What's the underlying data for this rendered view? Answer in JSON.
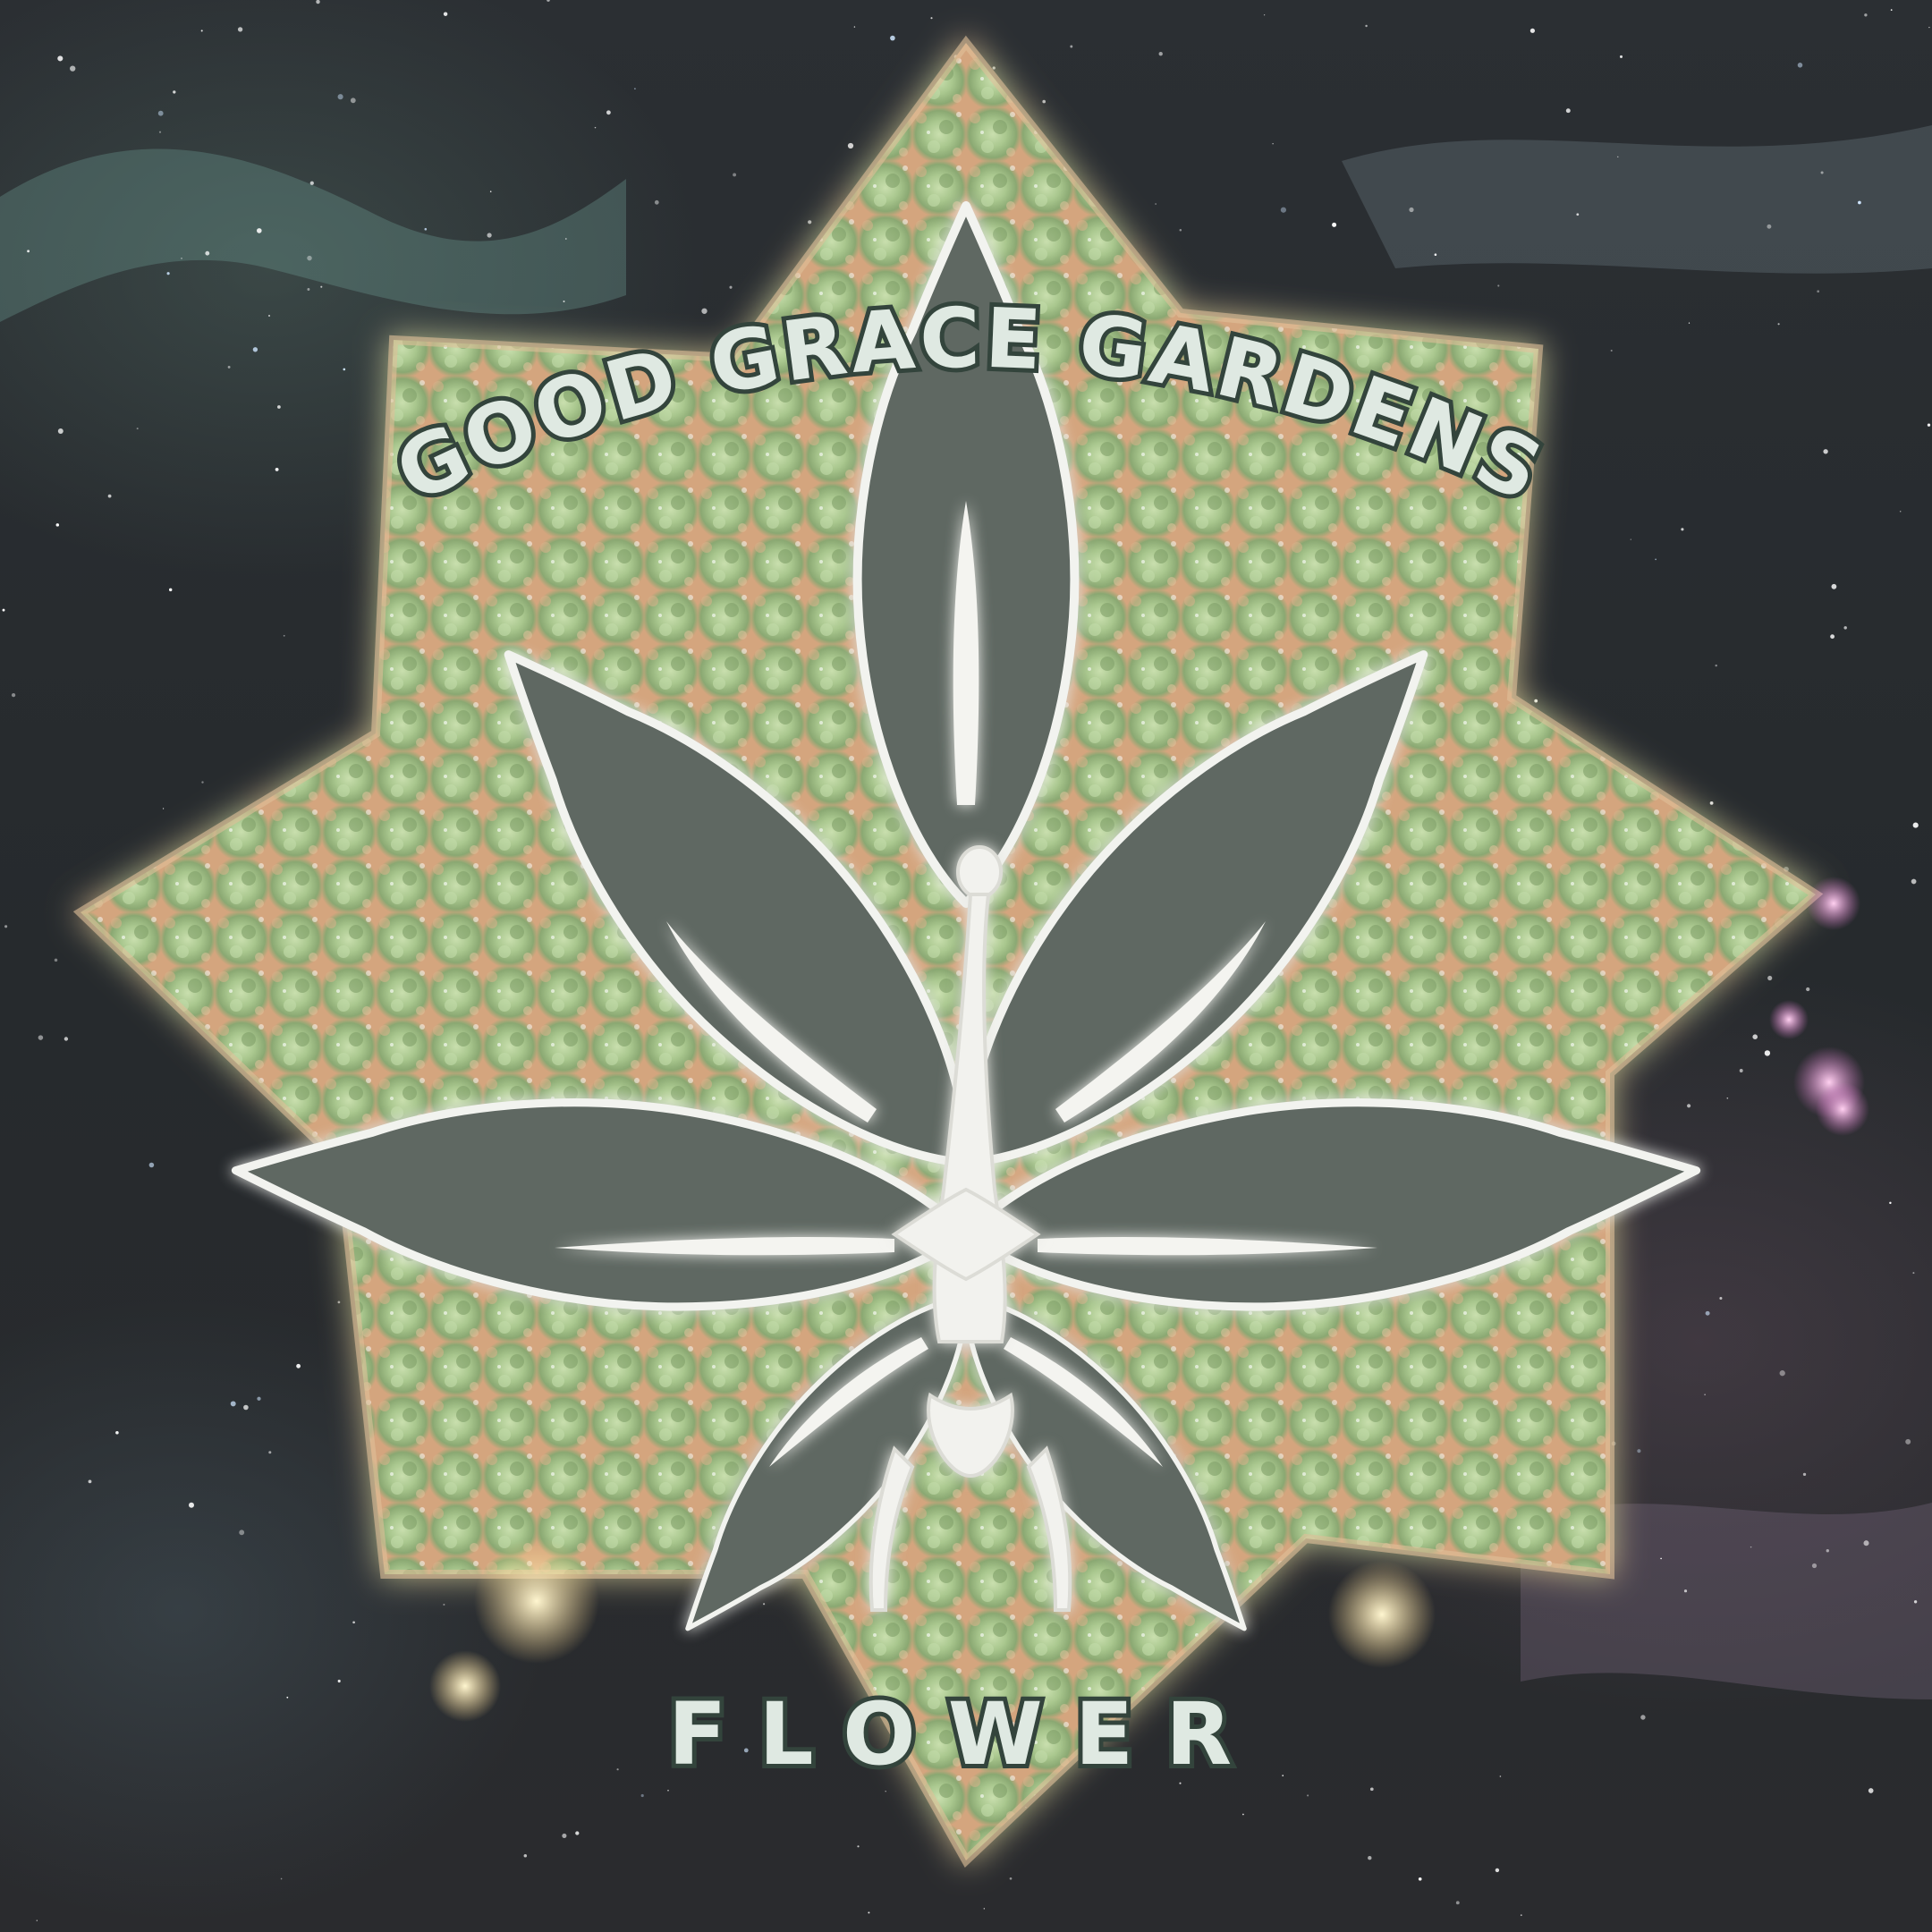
{
  "brand": {
    "name": "GOOD GRACE GARDENS",
    "subtitle": "FLOWER"
  },
  "colors": {
    "background": "#262a2d",
    "bud_light": "#b9d49a",
    "bud_dark": "#6f8a5c",
    "bud_orange": "#d9a47a",
    "leaf_fill": "#5f6862",
    "leaf_outline": "#f2f3ef",
    "text_fill": "#dfe9e2",
    "text_outline": "#33443c"
  },
  "icons": {
    "logo": "cannabis-leaf-icon",
    "emblem": "bud-emblem"
  }
}
